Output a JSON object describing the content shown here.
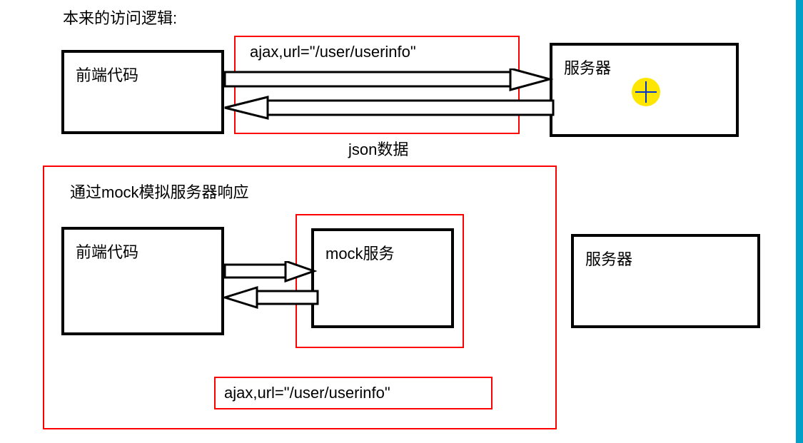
{
  "title_top": "本来的访问逻辑:",
  "frontend_label": "前端代码",
  "server_label": "服务器",
  "ajax_label": "ajax,url=\"/user/userinfo\"",
  "json_label": "json数据",
  "mock_section_title": "通过mock模拟服务器响应",
  "mock_service_label": "mock服务",
  "colors": {
    "highlight": "#ff0000",
    "target": "#ffe600",
    "target_cross": "#0033cc",
    "stripe": "#00a0c8"
  }
}
